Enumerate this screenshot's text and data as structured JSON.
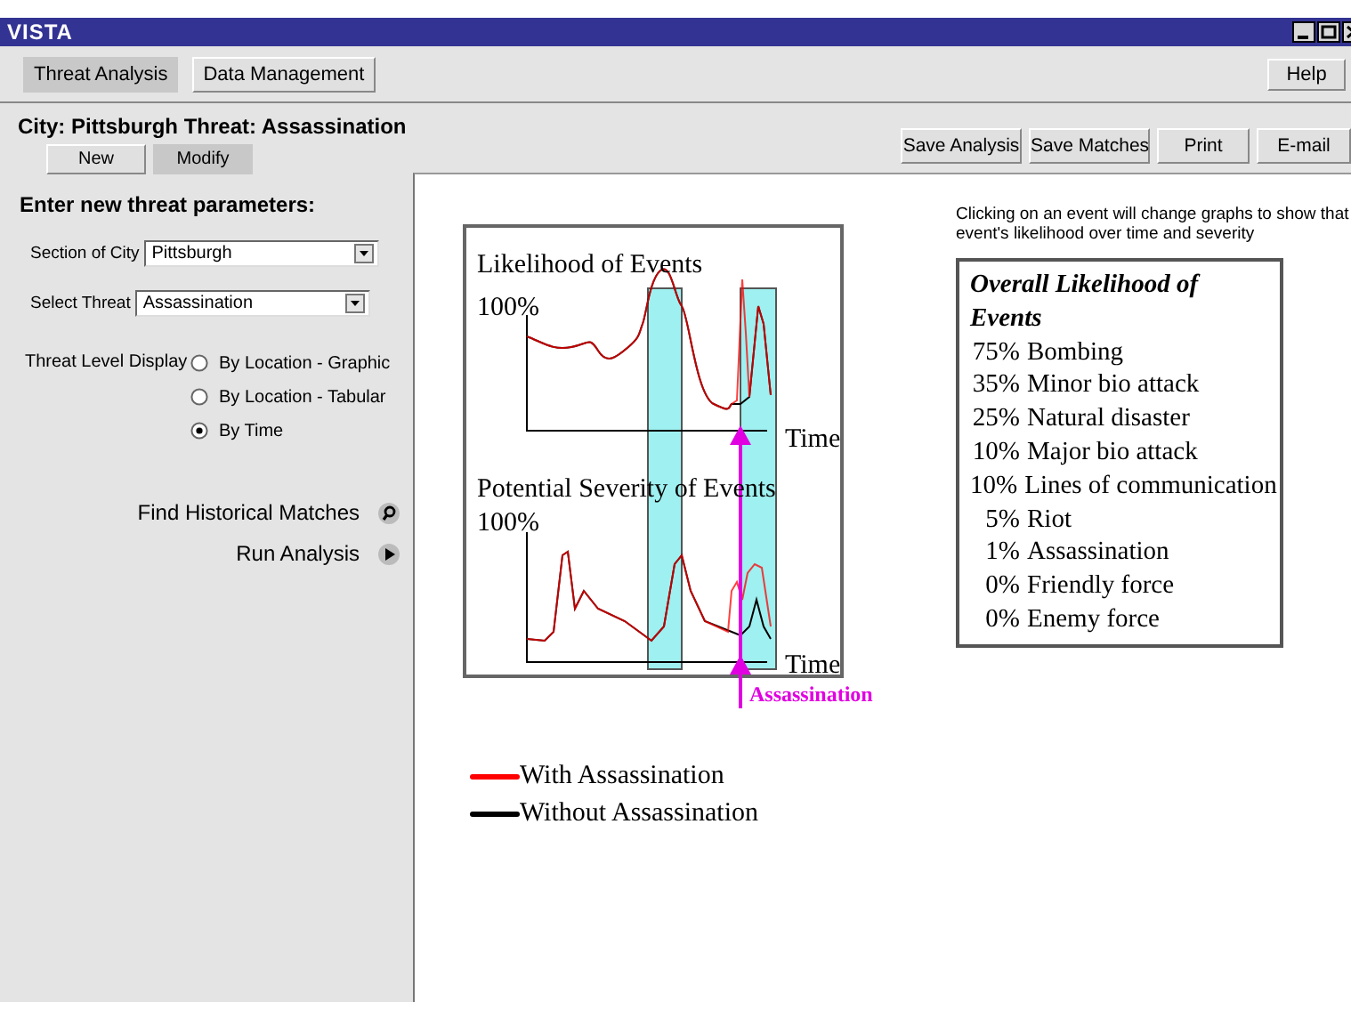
{
  "window": {
    "title": "VISTA"
  },
  "tabs": [
    {
      "label": "Threat Analysis",
      "selected": true
    },
    {
      "label": "Data Management",
      "selected": false
    }
  ],
  "help_button": "Help",
  "threat_header": "City: Pittsburgh Threat: Assassination",
  "mode_buttons": [
    {
      "label": "New",
      "selected": false
    },
    {
      "label": "Modify",
      "selected": true
    }
  ],
  "action_buttons": [
    "Save Analysis",
    "Save Matches",
    "Print",
    "E-mail"
  ],
  "parameters": {
    "heading": "Enter new threat parameters:",
    "fields": [
      {
        "label": "Section of City",
        "value": "Pittsburgh"
      },
      {
        "label": "Select Threat",
        "value": "Assassination"
      }
    ],
    "display": {
      "label": "Threat Level Display",
      "options": [
        {
          "label": "By Location -  Graphic",
          "selected": false
        },
        {
          "label": "By Location -  Tabular",
          "selected": false
        },
        {
          "label": "By Time",
          "selected": true
        }
      ]
    }
  },
  "commands": [
    {
      "label": "Find Historical Matches",
      "kind": "search"
    },
    {
      "label": "Run Analysis",
      "kind": "play"
    }
  ],
  "charts": {
    "likelihood": {
      "title": "Likelihood of Events",
      "y_label": "100%",
      "x_label": "Time"
    },
    "severity": {
      "title": "Potential Severity of Events",
      "y_label": "100%",
      "x_label": "Time"
    },
    "event_marker": "Assassination"
  },
  "legend": [
    {
      "label": "With Assassination",
      "color": "#ff0000"
    },
    {
      "label": "Without Assassination",
      "color": "#000000"
    }
  ],
  "hint": "Clicking on an event will change graphs to show that event's likelihood over time and severity",
  "likelihood_list": {
    "title": "Overall Likelihood of Events",
    "items": [
      {
        "percent": "75%",
        "event": "Bombing"
      },
      {
        "percent": "35%",
        "event": "Minor bio attack"
      },
      {
        "percent": "25%",
        "event": "Natural disaster"
      },
      {
        "percent": "10%",
        "event": "Major bio attack"
      },
      {
        "percent": "10%",
        "event": "Lines of communication"
      },
      {
        "percent": "5%",
        "event": "Riot"
      },
      {
        "percent": "1%",
        "event": "Assassination"
      },
      {
        "percent": "0%",
        "event": "Friendly force"
      },
      {
        "percent": "0%",
        "event": "Enemy force"
      }
    ]
  }
}
